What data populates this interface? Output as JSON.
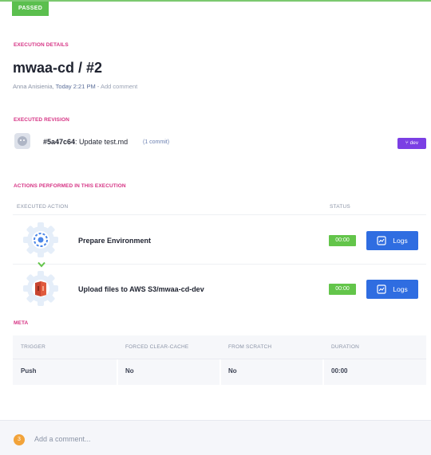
{
  "status_badge": "PASSED",
  "colors": {
    "accent_pink": "#d63384",
    "passed_green": "#5bbf4e",
    "logs_blue": "#2f6de1",
    "branch_purple": "#7b3fe4"
  },
  "execution_details": {
    "section_label": "EXECUTION DETAILS",
    "title": "mwaa-cd / #2",
    "author": "Anna Anisienia,",
    "time": "Today 2:21 PM",
    "separator": " - ",
    "add_comment": "Add comment"
  },
  "executed_revision": {
    "section_label": "EXECUTED REVISION",
    "commit_hash": "#5a47c64",
    "commit_message": ": Update test.md",
    "commit_count": "(1 commit)",
    "branch_icon": "branch-icon",
    "branch": "dev"
  },
  "actions": {
    "section_label": "ACTIONS PERFORMED IN THIS EXECUTION",
    "col_action": "EXECUTED ACTION",
    "col_status": "STATUS",
    "rows": [
      {
        "name": "Prepare Environment",
        "icon": "gear-settings-icon",
        "duration": "00:00",
        "logs_label": "Logs"
      },
      {
        "name": "Upload files to AWS S3/mwaa-cd-dev",
        "icon": "aws-s3-icon",
        "duration": "00:00",
        "logs_label": "Logs"
      }
    ]
  },
  "meta": {
    "section_label": "META",
    "headers": [
      "TRIGGER",
      "FORCED CLEAR-CACHE",
      "FROM SCRATCH",
      "DURATION"
    ],
    "values": [
      "Push",
      "No",
      "No",
      "00:00"
    ]
  },
  "comment_bar": {
    "count": "3",
    "placeholder": "Add a comment..."
  }
}
